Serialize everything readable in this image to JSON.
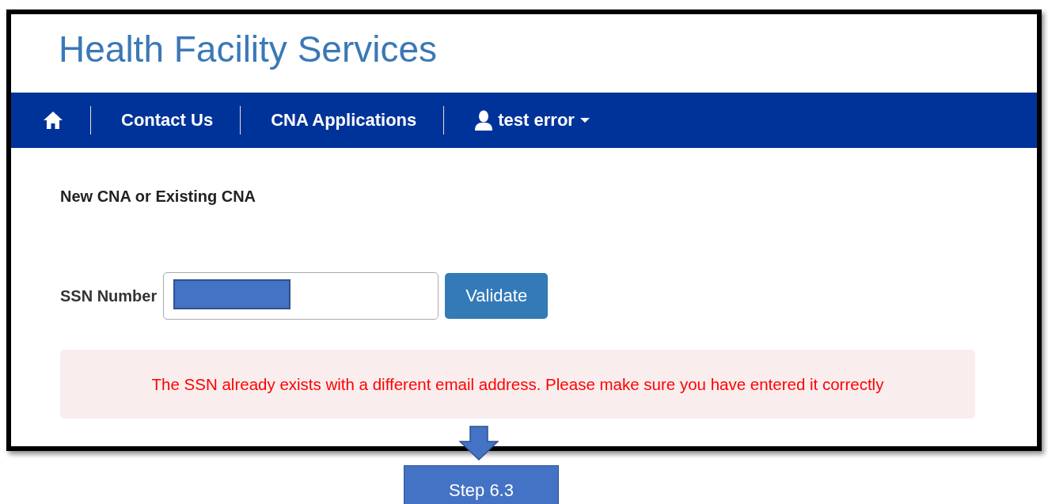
{
  "header": {
    "title": "Health Facility Services"
  },
  "nav": {
    "items": [
      {
        "kind": "home"
      },
      {
        "kind": "link",
        "label": "Contact Us"
      },
      {
        "kind": "link",
        "label": "CNA Applications"
      },
      {
        "kind": "user",
        "label": "test error"
      }
    ]
  },
  "form": {
    "heading": "New CNA or Existing CNA",
    "ssn_label": "SSN Number",
    "ssn_redacted": true,
    "button": "Validate"
  },
  "alert": {
    "message": "The SSN already exists with a different email address. Please make sure you have entered it correctly"
  },
  "callout": {
    "label": "Step 6.3"
  }
}
